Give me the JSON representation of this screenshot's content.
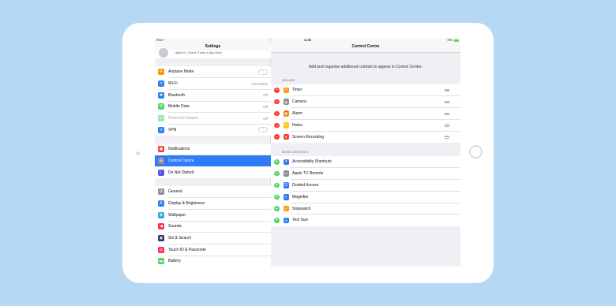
{
  "status": {
    "carrier": "iPad ᯤ",
    "time": "11:58",
    "battery": "78%"
  },
  "left": {
    "title": "Settings",
    "profile_subtitle": "Apple ID, iCloud, iTunes & App Store",
    "groups": [
      [
        {
          "label": "Airplane Mode",
          "icon": "airplane-icon",
          "glyph": "✈",
          "color": "#f79a00",
          "toggle": true
        },
        {
          "label": "Wi-Fi",
          "icon": "wifi-icon",
          "glyph": "ᯤ",
          "color": "#2f7cf6",
          "value": "icecebaby"
        },
        {
          "label": "Bluetooth",
          "icon": "bluetooth-icon",
          "glyph": "✱",
          "color": "#2f7cf6",
          "value": "Off"
        },
        {
          "label": "Mobile Data",
          "icon": "antenna-icon",
          "glyph": "Ψ",
          "color": "#4cd964",
          "value": "Off"
        },
        {
          "label": "Personal Hotspot",
          "icon": "hotspot-icon",
          "glyph": "∞",
          "color": "#4cd964",
          "value": "Off",
          "dim": true
        },
        {
          "label": "VPN",
          "icon": "vpn-icon",
          "glyph": "V",
          "color": "#2f7cf6",
          "toggle": true
        }
      ],
      [
        {
          "label": "Notifications",
          "icon": "notifications-icon",
          "glyph": "▣",
          "color": "#ff3b30"
        },
        {
          "label": "Control Centre",
          "icon": "control-centre-icon",
          "glyph": "☰",
          "color": "#8e8e93",
          "selected": true
        },
        {
          "label": "Do Not Disturb",
          "icon": "moon-icon",
          "glyph": "☾",
          "color": "#5856d6"
        }
      ],
      [
        {
          "label": "General",
          "icon": "gear-icon",
          "glyph": "⚙",
          "color": "#8e8e93"
        },
        {
          "label": "Display & Brightness",
          "icon": "brightness-icon",
          "glyph": "A",
          "color": "#2f7cf6"
        },
        {
          "label": "Wallpaper",
          "icon": "wallpaper-icon",
          "glyph": "❋",
          "color": "#34aadc"
        },
        {
          "label": "Sounds",
          "icon": "speaker-icon",
          "glyph": "◀",
          "color": "#ff2d55"
        },
        {
          "label": "Siri & Search",
          "icon": "siri-icon",
          "glyph": "◉",
          "color": "#333366"
        },
        {
          "label": "Touch ID & Passcode",
          "icon": "fingerprint-icon",
          "glyph": "◎",
          "color": "#ff2d55"
        },
        {
          "label": "Battery",
          "icon": "battery-icon",
          "glyph": "▬",
          "color": "#4cd964"
        }
      ]
    ]
  },
  "right": {
    "title": "Control Centre",
    "description": "Add and organise additional controls to appear in Control Centre.",
    "include_title": "INCLUDE",
    "more_title": "MORE CONTROLS",
    "include": [
      {
        "label": "Timer",
        "icon": "timer-icon",
        "glyph": "◷",
        "color": "#ff9500"
      },
      {
        "label": "Camera",
        "icon": "camera-icon",
        "glyph": "◙",
        "color": "#8e8e93"
      },
      {
        "label": "Alarm",
        "icon": "alarm-icon",
        "glyph": "⏰",
        "color": "#ff9500"
      },
      {
        "label": "Notes",
        "icon": "notes-icon",
        "glyph": "≡",
        "color": "#ffcc00"
      },
      {
        "label": "Screen Recording",
        "icon": "record-icon",
        "glyph": "●",
        "color": "#ff3b30"
      }
    ],
    "more": [
      {
        "label": "Accessibility Shortcuts",
        "icon": "accessibility-icon",
        "glyph": "♿",
        "color": "#2f7cf6"
      },
      {
        "label": "Apple TV Remote",
        "icon": "remote-icon",
        "glyph": "▭",
        "color": "#8e8e93"
      },
      {
        "label": "Guided Access",
        "icon": "lock-icon",
        "glyph": "⚿",
        "color": "#2f7cf6"
      },
      {
        "label": "Magnifier",
        "icon": "magnifier-icon",
        "glyph": "⌕",
        "color": "#2f7cf6"
      },
      {
        "label": "Stopwatch",
        "icon": "stopwatch-icon",
        "glyph": "◴",
        "color": "#ff9500"
      },
      {
        "label": "Text Size",
        "icon": "text-size-icon",
        "glyph": "A",
        "color": "#2f7cf6"
      }
    ]
  },
  "colors": {
    "background": "#b5d8f5",
    "accent": "#2f7cf6",
    "remove": "#ff3b30",
    "add": "#4cd964"
  }
}
